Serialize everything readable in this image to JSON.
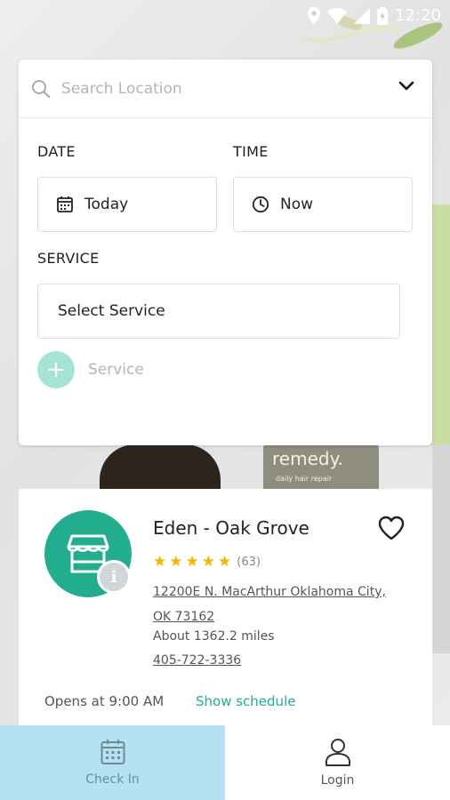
{
  "status_bar": {
    "time": "12:20"
  },
  "search": {
    "placeholder": "Search Location"
  },
  "date": {
    "label": "DATE",
    "value": "Today"
  },
  "time_field": {
    "label": "TIME",
    "value": "Now"
  },
  "service": {
    "label": "SERVICE",
    "select_value": "Select Service",
    "add_label": "Service"
  },
  "store": {
    "name": "Eden - Oak Grove",
    "rating_stars": 5,
    "rating_count": "(63)",
    "address": "12200E N. MacArthur Oklahoma City, OK 73162",
    "distance": "About 1362.2 miles",
    "phone": "405-722-3336",
    "opens": "Opens at 9:00 AM",
    "schedule_link": "Show schedule"
  },
  "bottom_nav": {
    "items": [
      {
        "label": "Check In",
        "active": true
      },
      {
        "label": "Login",
        "active": false
      }
    ]
  },
  "colors": {
    "accent": "#23ad8f",
    "active_tab": "#b5e1f0",
    "star": "#f5b800"
  },
  "background_text": {
    "bottle_brand": "remedy.",
    "bottle_sub": "daily hair repair"
  }
}
